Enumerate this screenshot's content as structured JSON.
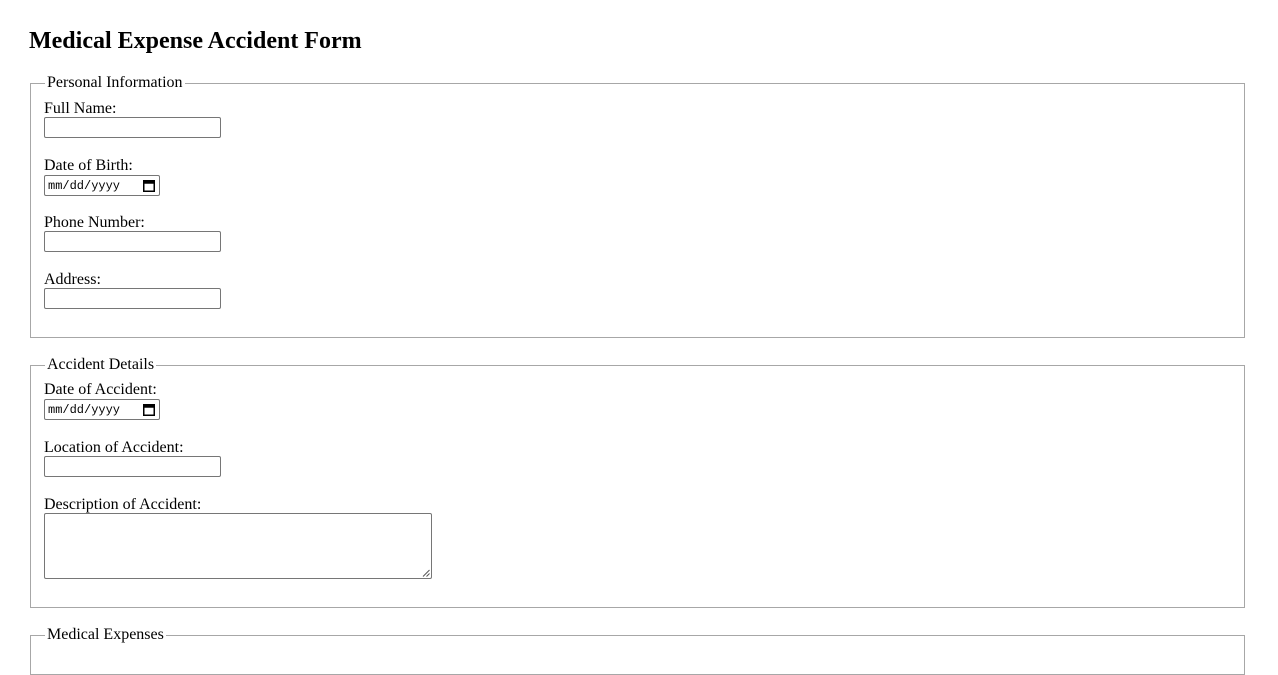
{
  "page": {
    "title": "Medical Expense Accident Form"
  },
  "personal": {
    "legend": "Personal Information",
    "full_name": {
      "label": "Full Name:",
      "value": ""
    },
    "dob": {
      "label": "Date of Birth:",
      "placeholder": "mm/dd/yyyy"
    },
    "phone": {
      "label": "Phone Number:",
      "value": ""
    },
    "address": {
      "label": "Address:",
      "value": ""
    }
  },
  "accident": {
    "legend": "Accident Details",
    "date": {
      "label": "Date of Accident:",
      "placeholder": "mm/dd/yyyy"
    },
    "location": {
      "label": "Location of Accident:",
      "value": ""
    },
    "description": {
      "label": "Description of Accident:",
      "value": ""
    }
  },
  "expenses": {
    "legend": "Medical Expenses"
  },
  "icons": {
    "date_picker": "calendar-icon",
    "textarea_resize": "resize-grip-icon"
  }
}
